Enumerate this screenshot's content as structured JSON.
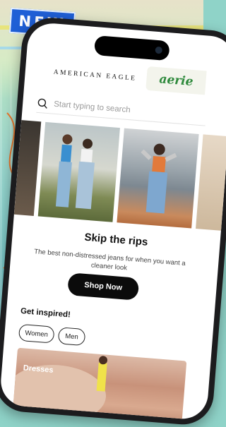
{
  "promo_badge": "NEW",
  "header": {
    "brand": "AMERICAN EAGLE",
    "alt_brand": "aerie"
  },
  "search": {
    "placeholder": "Start typing to search",
    "icon": "search-icon"
  },
  "hero": {
    "title": "Skip the rips",
    "description": "The best non-distressed jeans for when you want a cleaner look",
    "cta": "Shop Now"
  },
  "inspired": {
    "heading": "Get inspired!",
    "chips": [
      "Women",
      "Men"
    ]
  },
  "categories": [
    {
      "label": "Dresses"
    }
  ],
  "colors": {
    "badge": "#1f5fd6",
    "aerie_green": "#2f8a3d",
    "cta_background": "#0b0b0b"
  }
}
